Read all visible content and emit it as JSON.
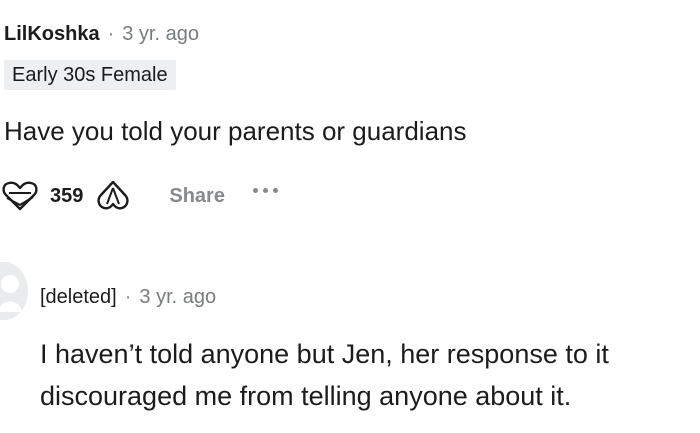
{
  "comment_1": {
    "author": "LilKoshka",
    "separator": "·",
    "time": "3 yr. ago",
    "flair": "Early 30s Female",
    "body": "Have you told your parents or guardians",
    "vote_count": "359",
    "share_label": "Share",
    "icons": {
      "upvote": "heart-upvote-icon",
      "downvote": "heart-downvote-icon",
      "more": "more-options-icon"
    }
  },
  "comment_2": {
    "author": "[deleted]",
    "separator": "·",
    "time": "3 yr. ago",
    "body_line_1": "I haven’t told anyone but Jen, her response to it",
    "body_line_2": "discouraged me from telling anyone about it.",
    "icons": {
      "avatar": "default-avatar-icon"
    }
  },
  "colors": {
    "text": "#1c1c1c",
    "meta": "#787c7e",
    "action_grey": "#878a8c",
    "flair_bg": "#edeff1"
  }
}
